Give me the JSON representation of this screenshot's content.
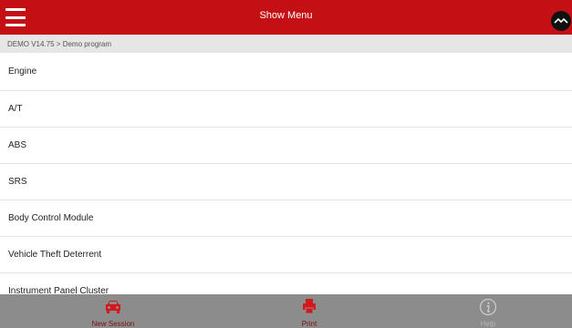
{
  "header": {
    "title": "Show Menu"
  },
  "breadcrumb": {
    "text": "DEMO V14.75 > Demo program"
  },
  "menu": {
    "items": [
      {
        "label": "Engine"
      },
      {
        "label": "A/T"
      },
      {
        "label": "ABS"
      },
      {
        "label": "SRS"
      },
      {
        "label": "Body Control Module"
      },
      {
        "label": "Vehicle Theft Deterrent"
      },
      {
        "label": "Instrument Panel Cluster"
      }
    ]
  },
  "toolbar": {
    "new_session_label": "New Session",
    "print_label": "Print",
    "help_label": "Help"
  },
  "colors": {
    "accent": "#c40f14",
    "toolbar_bg": "#8c8c8c",
    "breadcrumb_bg": "#e6e6e6"
  },
  "icons": {
    "menu": "hamburger-icon",
    "corner": "chevron-toggle-icon",
    "new_session": "car-icon",
    "print": "printer-icon",
    "help": "info-icon"
  }
}
